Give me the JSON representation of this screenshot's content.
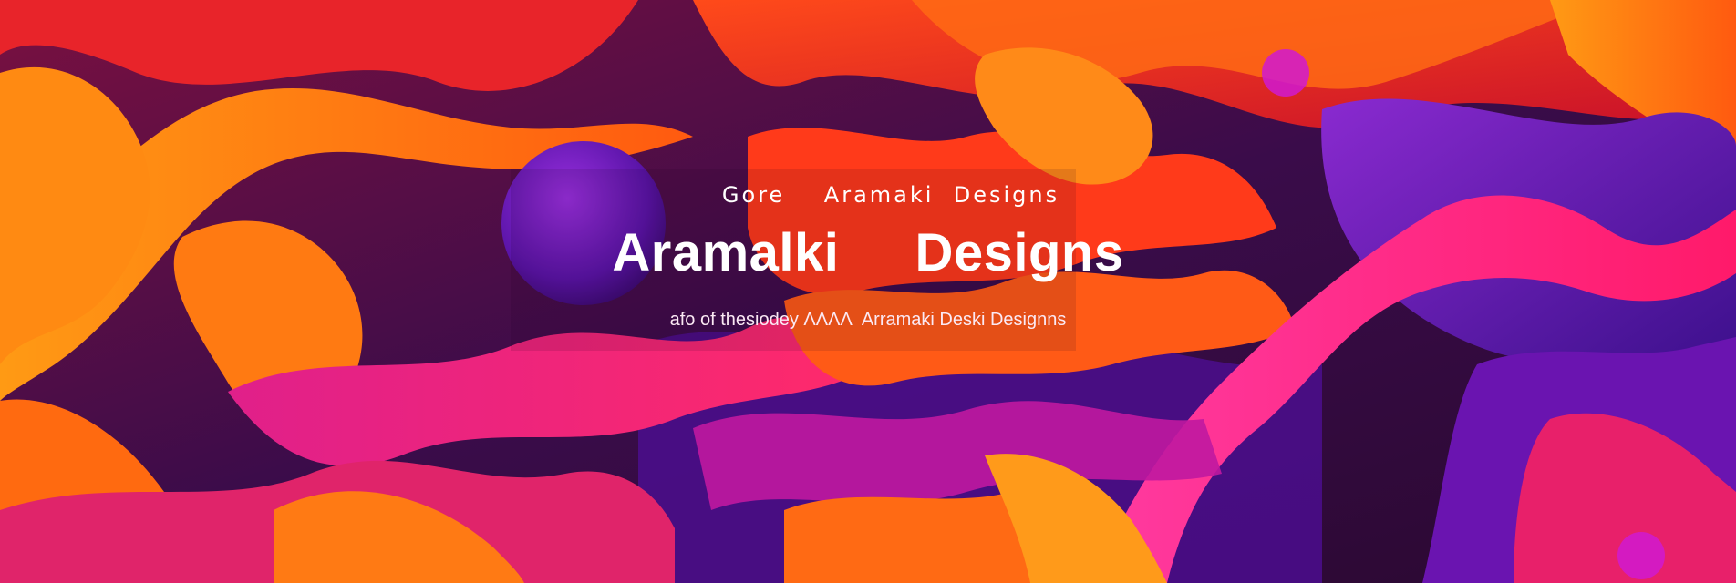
{
  "banner": {
    "top_line": "Gore    Aramaki  Designs",
    "title": "Aramalki     Designs",
    "tagline": "afo of thesiodey ΛΛΛΛ  Arramaki Deski Designns"
  },
  "palette": {
    "deep_purple": "#2a0a3a",
    "violet": "#6a1fb0",
    "magenta": "#e0208a",
    "red": "#e8242a",
    "orange": "#ff7a12",
    "amber": "#ffa31a"
  }
}
